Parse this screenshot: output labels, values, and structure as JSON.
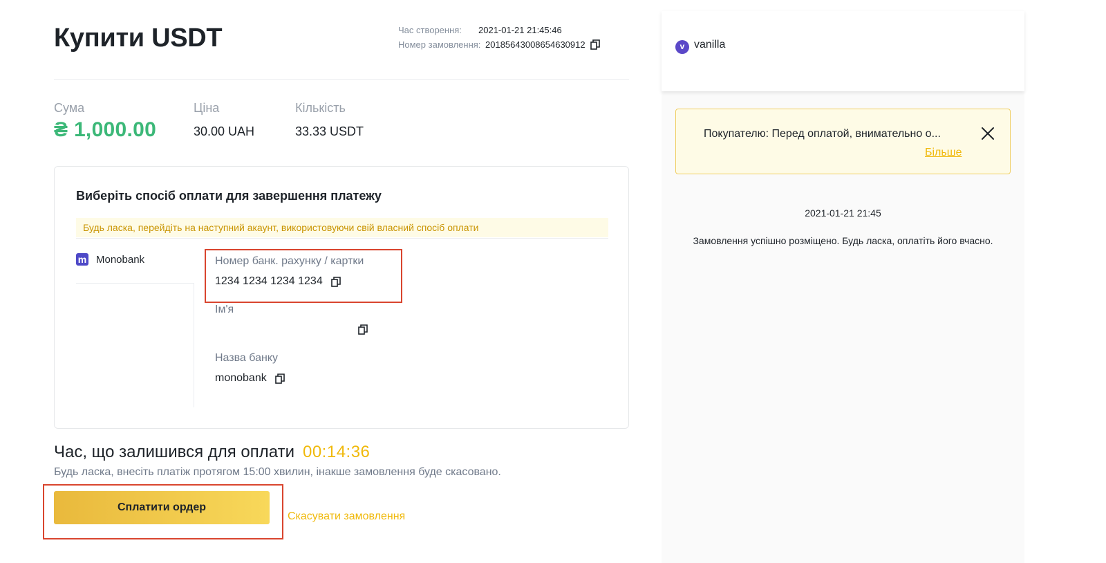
{
  "order": {
    "title": "Купити USDT",
    "created_label": "Час створення:",
    "created_value": "2021-01-21 21:45:46",
    "number_label": "Номер замовлення:",
    "number_value": "20185643008654630912"
  },
  "summary": {
    "amount_label": "Сума",
    "amount_value": "₴ 1,000.00",
    "price_label": "Ціна",
    "price_value": "30.00 UAH",
    "quantity_label": "Кількість",
    "quantity_value": "33.33 USDT"
  },
  "payment": {
    "title": "Виберіть спосіб оплати для завершення платежу",
    "notice": "Будь ласка, перейдіть на наступний акаунт, використовуючи свій власний спосіб оплати",
    "method": {
      "logo_letter": "m",
      "name": "Monobank"
    },
    "fields": {
      "account_label": "Номер банк. рахунку / картки",
      "account_value": "1234 1234 1234 1234",
      "name_label": "Ім'я",
      "name_value": "",
      "bank_label": "Назва банку",
      "bank_value": "monobank"
    }
  },
  "timer": {
    "label": "Час, що залишився для оплати",
    "value": "00:14:36",
    "note": "Будь ласка, внесіть платіж протягом 15:00 хвилин, інакше замовлення буде скасовано."
  },
  "actions": {
    "pay_label": "Сплатити ордер",
    "cancel_label": "Скасувати замовлення"
  },
  "chat": {
    "avatar_letter": "v",
    "username": "vanilla",
    "notice_text": "Покупателю: Перед оплатой, внимательно о...",
    "notice_more": "Більше",
    "time": "2021-01-21 21:45",
    "message": "Замовлення успішно розміщено. Будь ласка, оплатіть його вчасно."
  },
  "colors": {
    "accent": "#f0b90b",
    "amount_green": "#3cb878",
    "highlight_red": "#d9452e",
    "monobank_purple": "#4e49c7"
  },
  "icons": [
    "copy-icon",
    "close-icon",
    "monobank-logo-icon",
    "avatar"
  ]
}
